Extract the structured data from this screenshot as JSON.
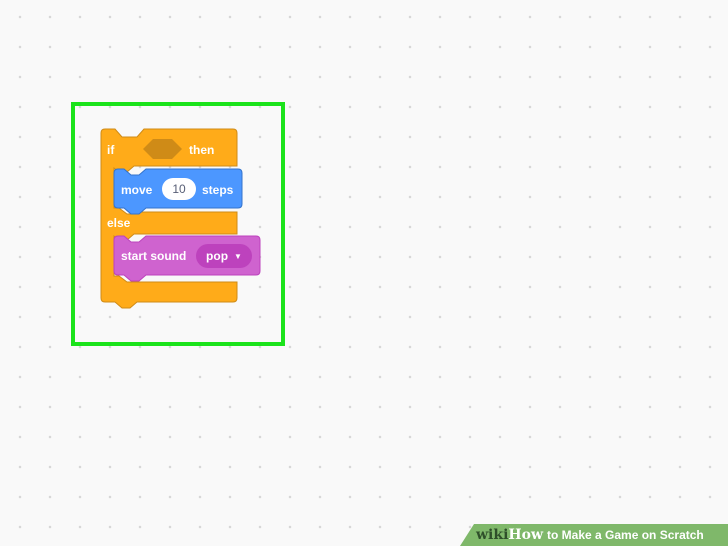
{
  "colors": {
    "control": "#ffab19",
    "control_dark": "#cf8b17",
    "motion": "#4c97ff",
    "sound": "#cf63cf",
    "highlight": "#1be31b"
  },
  "blocks": {
    "if_label": "if",
    "then_label": "then",
    "else_label": "else",
    "move_label": "move",
    "move_value": "10",
    "steps_label": "steps",
    "start_sound_label": "start sound",
    "sound_value": "pop"
  },
  "watermark": {
    "wiki": "wiki",
    "how": "How",
    "title": "to Make a Game on Scratch"
  }
}
